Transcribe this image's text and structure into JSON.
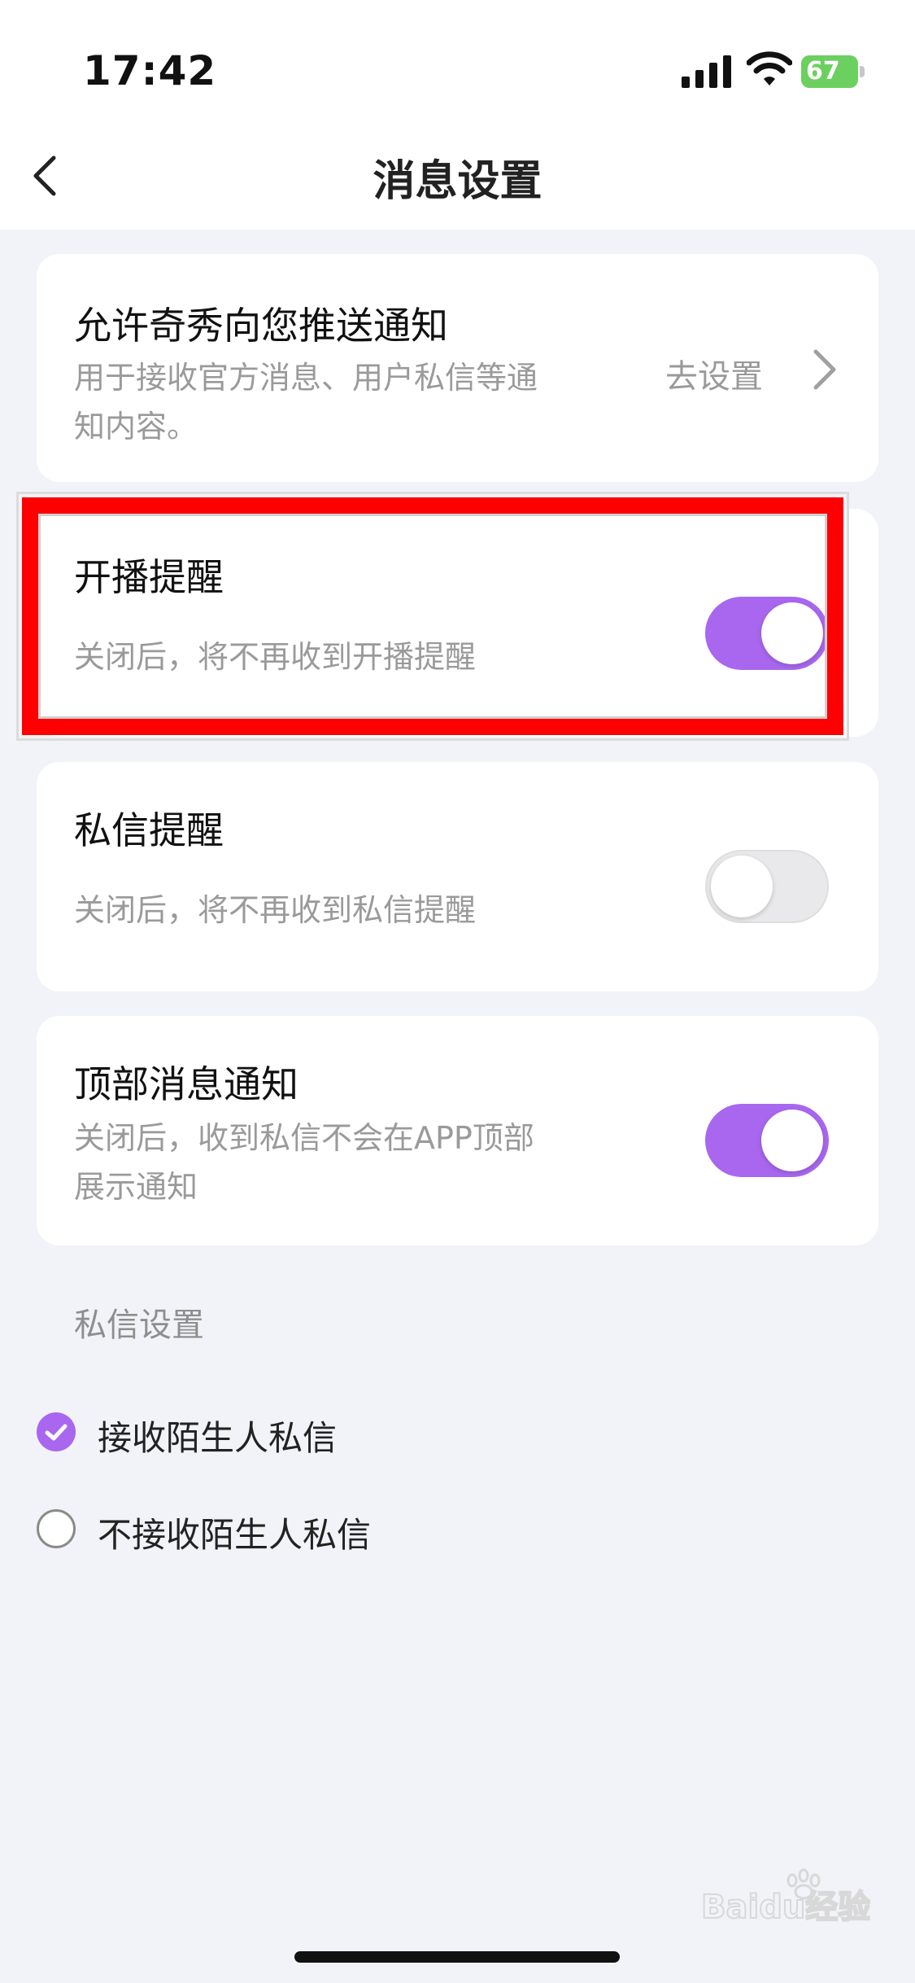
{
  "status_bar": {
    "time": "17:42",
    "battery": "67"
  },
  "nav": {
    "title": "消息设置"
  },
  "push_card": {
    "title": "允许奇秀向您推送通知",
    "desc_line1": "用于接收官方消息、用户私信等通",
    "desc_line2": "知内容。",
    "action_label": "去设置"
  },
  "toggles": [
    {
      "title": "开播提醒",
      "desc_line1": "关闭后，将不再收到开播提醒",
      "desc_line2": "",
      "on": true
    },
    {
      "title": "私信提醒",
      "desc_line1": "关闭后，将不再收到私信提醒",
      "desc_line2": "",
      "on": false
    },
    {
      "title": "顶部消息通知",
      "desc_line1": "关闭后，收到私信不会在APP顶部",
      "desc_line2": "展示通知",
      "on": true
    }
  ],
  "dm_settings": {
    "section_label": "私信设置",
    "options": [
      {
        "label": "接收陌生人私信",
        "selected": true
      },
      {
        "label": "不接收陌生人私信",
        "selected": false
      }
    ]
  },
  "watermark": {
    "text": "Baidu经验"
  },
  "colors": {
    "accent": "#a867ee",
    "highlight": "#ff0000",
    "background": "#f1f3f8"
  }
}
